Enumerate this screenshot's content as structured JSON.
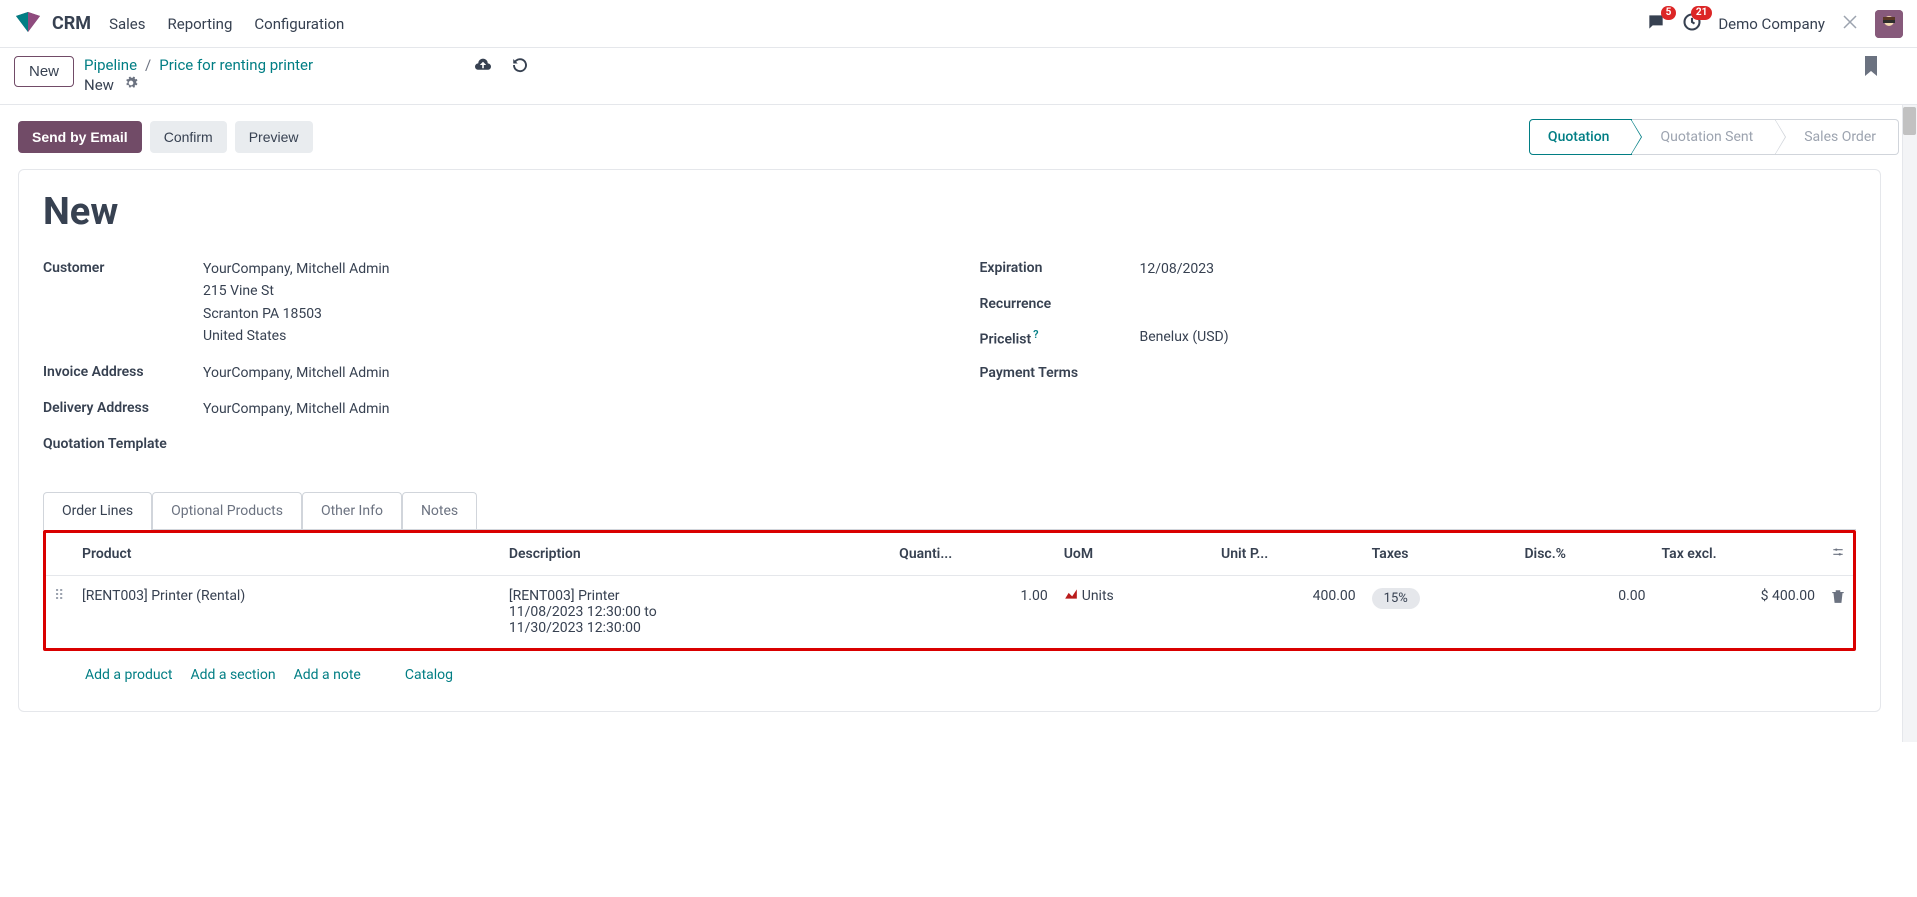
{
  "topbar": {
    "brand": "CRM",
    "menu": [
      "Sales",
      "Reporting",
      "Configuration"
    ],
    "messages_badge": "5",
    "activities_badge": "21",
    "company": "Demo Company"
  },
  "breadcrumb": {
    "new_button": "New",
    "root": "Pipeline",
    "leaf": "Price for renting printer",
    "status": "New"
  },
  "actions": {
    "send_email": "Send by Email",
    "confirm": "Confirm",
    "preview": "Preview"
  },
  "stages": [
    "Quotation",
    "Quotation Sent",
    "Sales Order"
  ],
  "active_stage": "Quotation",
  "form": {
    "title": "New",
    "left": {
      "customer_label": "Customer",
      "customer_name": "YourCompany, Mitchell Admin",
      "customer_addr1": "215 Vine St",
      "customer_addr2": "Scranton PA 18503",
      "customer_addr3": "United States",
      "invoice_label": "Invoice Address",
      "invoice_val": "YourCompany, Mitchell Admin",
      "delivery_label": "Delivery Address",
      "delivery_val": "YourCompany, Mitchell Admin",
      "template_label": "Quotation Template"
    },
    "right": {
      "expiration_label": "Expiration",
      "expiration_val": "12/08/2023",
      "recurrence_label": "Recurrence",
      "pricelist_label": "Pricelist",
      "pricelist_val": "Benelux (USD)",
      "payment_label": "Payment Terms"
    }
  },
  "tabs": [
    "Order Lines",
    "Optional Products",
    "Other Info",
    "Notes"
  ],
  "active_tab": "Order Lines",
  "table": {
    "headers": {
      "product": "Product",
      "description": "Description",
      "quantity": "Quanti...",
      "uom": "UoM",
      "unit_price": "Unit P...",
      "taxes": "Taxes",
      "disc": "Disc.%",
      "tax_excl": "Tax excl."
    },
    "rows": [
      {
        "product": "[RENT003] Printer (Rental)",
        "desc_l1": "[RENT003] Printer",
        "desc_l2": "11/08/2023 12:30:00 to",
        "desc_l3": "11/30/2023 12:30:00",
        "qty": "1.00",
        "uom": "Units",
        "unit_price": "400.00",
        "tax": "15%",
        "disc": "0.00",
        "tax_excl": "$ 400.00"
      }
    ]
  },
  "add_links": {
    "product": "Add a product",
    "section": "Add a section",
    "note": "Add a note",
    "catalog": "Catalog"
  }
}
